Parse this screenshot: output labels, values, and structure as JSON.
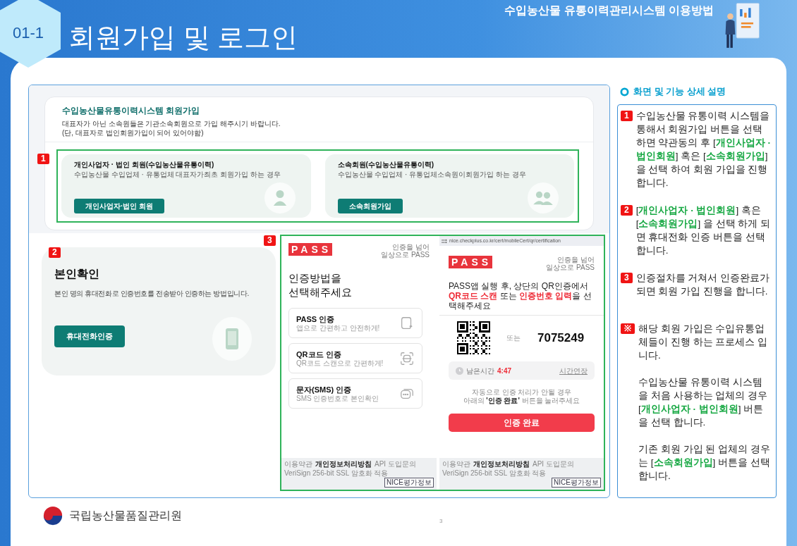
{
  "header": {
    "badge": "01-1",
    "title": "회원가입 및 로그인",
    "subtitle": "수입농산물 유통이력관리시스템 이용방법"
  },
  "signup_screen": {
    "title": "수입농산물유통이력시스템 회원가입",
    "notes": [
      "대표자가 아닌 소속원들은 기관소속회원으로 가입 해주시기 바랍니다.",
      "(단, 대표자로 법인회원가입이 되어 있어야함)"
    ],
    "marker": "1",
    "cards": [
      {
        "kind": "single",
        "title": "개인사업자 · 법인 회원(수입농산물유통이력)",
        "description": "수입농산물 수입업체 · 유통업체 대표자가최초 회원가입 하는 경우",
        "button": "개인사업자·법인 회원"
      },
      {
        "kind": "group",
        "title": "소속회원(수입농산물유통이력)",
        "description": "수입농산물 수입업체 · 유통업체소속원이회원가입 하는 경우",
        "button": "소속회원가입"
      }
    ]
  },
  "identity_screen": {
    "marker": "2",
    "title": "본인확인",
    "description": "본인 명의 휴대전화로 인증번호를 전송받아 인증하는 방법입니다.",
    "button": "휴대전화인증"
  },
  "pass_screens": {
    "marker": "3",
    "method_screen": {
      "logo": "PASS",
      "slogan": [
        "인증을 넘어",
        "일상으로 PASS"
      ],
      "heading": [
        "인증방법을",
        "선택해주세요"
      ],
      "options": [
        {
          "kind": "app",
          "title": "PASS 인증",
          "description": "앱으로 간편하고 안전하게!"
        },
        {
          "kind": "qr",
          "title": "QR코드 인증",
          "description": "QR코드 스캔으로 간편하게!"
        },
        {
          "kind": "sms",
          "title": "문자(SMS) 인증",
          "description": "SMS 인증번호로 본인확인"
        }
      ],
      "footer": {
        "links": [
          "이용약관",
          "개인정보처리방침",
          "API 도입문의"
        ],
        "security": "VeriSign 256-bit SSL 암호화 적용",
        "badge": "NICE평가정보"
      }
    },
    "qr_screen": {
      "url": "nice.checkplus.co.kr/cert/mobileCert/qr/certification",
      "logo": "PASS",
      "slogan": [
        "인증을 넘어",
        "일상으로 PASS"
      ],
      "instruction": "PASS앱 실행 후, 상단의 QR인증에서 **QR코드 스캔** 또는 **인증번호 입력**을 선택해주세요",
      "or_label": "또는",
      "code": "7075249",
      "timer_label": "남은시간",
      "timer": "4:47",
      "extend": "시간연장",
      "help": [
        "자동으로 인증 처리가 안될 경우",
        "아래의 **'인증 완료'** 버튼을 눌러주세요"
      ],
      "confirm_button": "인증 완료",
      "footer": {
        "links": [
          "이용약관",
          "개인정보처리방침",
          "API 도입문의"
        ],
        "security": "VeriSign 256-bit SSL 암호화 적용",
        "badge": "NICE평가정보"
      }
    }
  },
  "description_panel": {
    "heading": "화면 및 기능 상세 설명",
    "items": [
      {
        "kind": "step",
        "marker": "1",
        "paragraphs": [
          "수입농산물 유통이력 시스템을 통해서 회원가입 버튼을 선택 하면  약관동의 후 [**개인사업자 · 법인회원**] 혹은 [**소속회원가입**]을 선택 하여 회원 가입을 진행 합니다."
        ]
      },
      {
        "kind": "step",
        "marker": "2",
        "paragraphs": [
          "[**개인사업자 · 법인회원**] 혹은 [**소속회원가입**] 을 선택 하게 되면 휴대전화 인증 버튼을 선택 합니다."
        ]
      },
      {
        "kind": "step",
        "marker": "3",
        "paragraphs": [
          "인증절차를 거쳐서 인증완료가 되면 회원 가입 진행을 합니다."
        ]
      },
      {
        "kind": "note",
        "marker": "※",
        "paragraphs": [
          "해당 회원 가입은 수입유통업체들이 진행 하는 프로세스 입니다.",
          "수입농산물 유통이력 시스템을 처음 사용하는 업체의 경우 [**개인사업자 · 법인회원**]  버튼을 선택 합니다.",
          "기존 회원 가입 된 업체의 경우는 [**소속회원가입**] 버튼을 선택 합니다."
        ]
      }
    ]
  },
  "footer": {
    "org": "국립농산물품질관리원",
    "page": "3"
  }
}
